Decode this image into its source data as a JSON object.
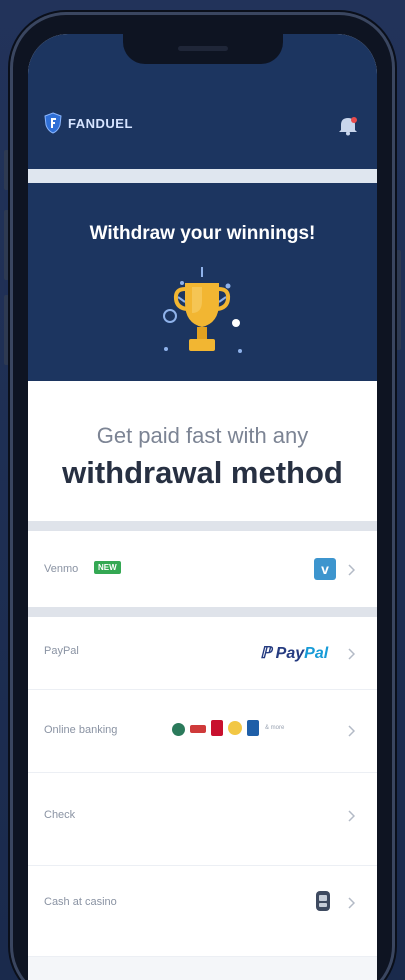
{
  "app": {
    "brand": "FANDUEL",
    "hero_title": "Withdraw your winnings!",
    "promo_line1": "Get paid fast with any",
    "promo_line2": "withdrawal method"
  },
  "methods": [
    {
      "label": "Venmo",
      "badge": "NEW",
      "icon": "venmo-icon"
    },
    {
      "label": "PayPal",
      "logo_text_pay": "Pay",
      "logo_text_pal": "Pal",
      "icon": "paypal-icon"
    },
    {
      "label": "Online banking",
      "trailing_text": "& more",
      "icon": "bank-logos-icon"
    },
    {
      "label": "Check",
      "icon": "chevron-right-icon"
    },
    {
      "label": "Cash at casino",
      "icon": "cash-cage-icon"
    }
  ],
  "colors": {
    "navy": "#1c3560",
    "gold": "#f2b632",
    "venmo_blue": "#3d95ce",
    "paypal_dark": "#253b80",
    "paypal_light": "#179bd7",
    "badge_green": "#34a853"
  }
}
